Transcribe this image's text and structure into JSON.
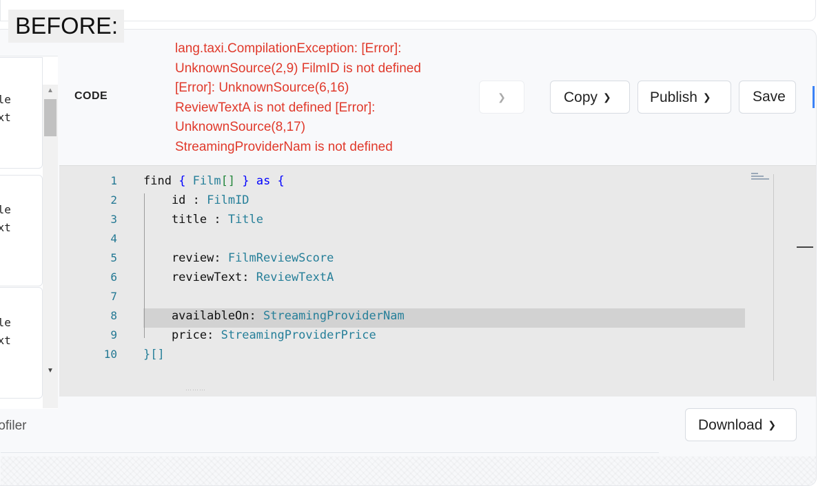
{
  "overlay": {
    "before_label": "BEFORE:"
  },
  "left_list": {
    "cards": [
      {
        "line1": "tle",
        "line2": "ext"
      },
      {
        "line1": "tle",
        "line2": "ext"
      },
      {
        "line1": "tle",
        "line2": "ext"
      }
    ]
  },
  "header": {
    "code_label": "CODE",
    "error_lines": [
      "lang.taxi.CompilationException: [Error]:",
      "UnknownSource(2,9) FilmID is not defined",
      "[Error]: UnknownSource(6,16)",
      "ReviewTextA is not defined [Error]:",
      "UnknownSource(8,17)",
      "StreamingProviderNam is not defined"
    ],
    "copy_label": "Copy",
    "publish_label": "Publish",
    "save_label": "Save"
  },
  "editor": {
    "line_numbers": [
      "1",
      "2",
      "3",
      "4",
      "5",
      "6",
      "7",
      "8",
      "9",
      "10"
    ],
    "lines": [
      [
        {
          "t": "find ",
          "c": ""
        },
        {
          "t": "{ ",
          "c": "kw"
        },
        {
          "t": "Film",
          "c": "ty"
        },
        {
          "t": "[] ",
          "c": "gr"
        },
        {
          "t": "} ",
          "c": "kw"
        },
        {
          "t": "as ",
          "c": "kw"
        },
        {
          "t": "{",
          "c": "kw"
        }
      ],
      [
        {
          "t": "    id : ",
          "c": ""
        },
        {
          "t": "FilmID",
          "c": "ty"
        }
      ],
      [
        {
          "t": "    title : ",
          "c": ""
        },
        {
          "t": "Title",
          "c": "ty"
        }
      ],
      [],
      [
        {
          "t": "    review: ",
          "c": ""
        },
        {
          "t": "FilmReviewScore",
          "c": "ty"
        }
      ],
      [
        {
          "t": "    reviewText: ",
          "c": ""
        },
        {
          "t": "ReviewTextA",
          "c": "ty"
        }
      ],
      [],
      [
        {
          "t": "    availableOn: ",
          "c": ""
        },
        {
          "t": "StreamingProviderNam",
          "c": "ty"
        }
      ],
      [
        {
          "t": "    price: ",
          "c": ""
        },
        {
          "t": "StreamingProviderPrice",
          "c": "ty"
        }
      ],
      [
        {
          "t": "}[]",
          "c": "ty"
        }
      ]
    ],
    "active_line": 8,
    "colors": {
      "keyword": "#0000ff",
      "type": "#267f99",
      "brackets": "#22863a"
    }
  },
  "bottom": {
    "profiler_label": "rofiler",
    "download_label": "Download"
  },
  "colors": {
    "error": "#e0392b",
    "accent": "#3b82f6"
  }
}
